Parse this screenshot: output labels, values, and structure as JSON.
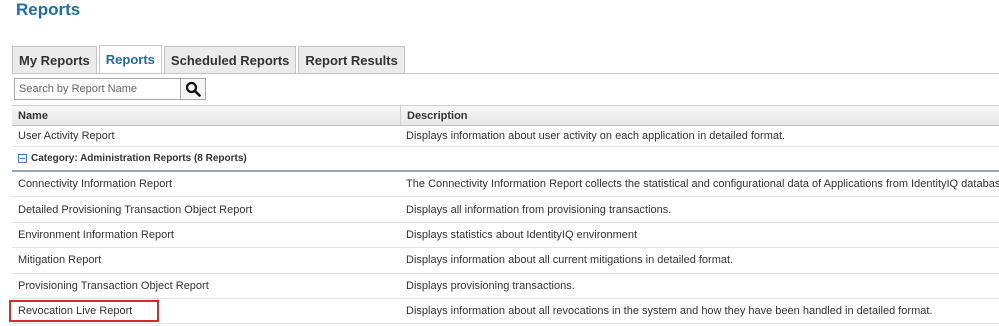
{
  "page": {
    "title": "Reports"
  },
  "tabs": [
    {
      "label": "My Reports",
      "active": false
    },
    {
      "label": "Reports",
      "active": true
    },
    {
      "label": "Scheduled Reports",
      "active": false
    },
    {
      "label": "Report Results",
      "active": false
    }
  ],
  "search": {
    "placeholder": "Search by Report Name",
    "value": "",
    "icon": "search-icon"
  },
  "grid": {
    "columns": {
      "name": "Name",
      "description": "Description"
    },
    "rows_before_group": [
      {
        "name": "User Activity Report",
        "description": "Displays information about user activity on each application in detailed format."
      }
    ],
    "group": {
      "label": "Category: Administration Reports (8 Reports)",
      "icon": "collapse-icon"
    },
    "rows": [
      {
        "name": "Connectivity Information Report",
        "description": "The Connectivity Information Report collects the statistical and configurational data of Applications from IdentityIQ database based on filter criteria."
      },
      {
        "name": "Detailed Provisioning Transaction Object Report",
        "description": "Displays all information from provisioning transactions."
      },
      {
        "name": "Environment Information Report",
        "description": "Displays statistics about IdentityIQ environment"
      },
      {
        "name": "Mitigation Report",
        "description": "Displays information about all current mitigations in detailed format."
      },
      {
        "name": "Provisioning Transaction Object Report",
        "description": "Displays provisioning transactions."
      },
      {
        "name": "Revocation Live Report",
        "description": "Displays information about all revocations in the system and how they have been handled in detailed format."
      }
    ]
  },
  "colors": {
    "accent": "#1f6f9e",
    "highlight": "#d42a2a"
  }
}
